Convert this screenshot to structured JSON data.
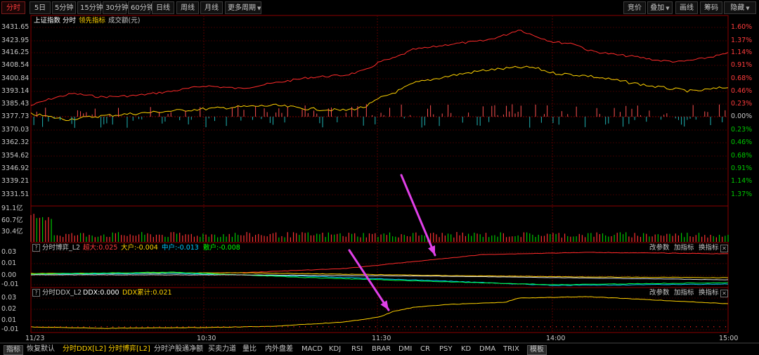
{
  "toolbar": {
    "left": [
      {
        "label": "分时",
        "active": true
      },
      {
        "label": "5日"
      },
      {
        "label": "5分钟"
      },
      {
        "label": "15分钟"
      },
      {
        "label": "30分钟"
      },
      {
        "label": "60分钟"
      },
      {
        "label": "日线"
      },
      {
        "label": "周线"
      },
      {
        "label": "月线"
      },
      {
        "label": "更多周期"
      }
    ],
    "right": [
      "竞价",
      "叠加",
      "画线",
      "筹码",
      "隐藏"
    ]
  },
  "main_chart": {
    "legend": [
      {
        "text": "上证指数",
        "color": "#ffffff"
      },
      {
        "text": "分时",
        "color": "#ffffff"
      },
      {
        "text": "领先指标",
        "color": "#ffd200"
      },
      {
        "text": "成交额(元)",
        "color": "#c8c8c8"
      }
    ],
    "left_axis": [
      "3431.65",
      "3423.95",
      "3416.25",
      "3408.54",
      "3400.84",
      "3393.14",
      "3385.43",
      "3377.73",
      "3370.03",
      "3362.32",
      "3354.62",
      "3346.92",
      "3339.21",
      "3331.51"
    ],
    "right_axis": [
      "1.60%",
      "1.37%",
      "1.14%",
      "0.91%",
      "0.68%",
      "0.46%",
      "0.23%",
      "0.00%",
      "0.23%",
      "0.46%",
      "0.68%",
      "0.91%",
      "1.14%",
      "1.37%"
    ],
    "right_axis_colors": {
      "up": "#ff3c3c",
      "zero": "#c8c8c8",
      "down": "#00c800"
    },
    "colors": {
      "price": "#ff2a2a",
      "lead": "#ffd200",
      "bar_up": "#ff5050",
      "bar_down": "#20b4b4"
    }
  },
  "volume_panel": {
    "axis": [
      "91.1亿",
      "60.7亿",
      "30.4亿"
    ],
    "bar_colors": {
      "up": "#ff3232",
      "down": "#00c800"
    }
  },
  "panel_boyi": {
    "title": "分时博弈_L2",
    "items": [
      {
        "text": "超大:0.025",
        "color": "#ff3c3c"
      },
      {
        "text": "大户:-0.004",
        "color": "#ffd200"
      },
      {
        "text": "中户:-0.013",
        "color": "#00c8ff"
      },
      {
        "text": "散户:-0.008",
        "color": "#00ff00"
      }
    ],
    "buttons": [
      "改参数",
      "加指标",
      "换指标"
    ],
    "axis": [
      "0.03",
      "0.01",
      "0.00",
      "-0.01"
    ],
    "colors": {
      "super": "#ff2a2a",
      "big": "#ffd200",
      "mid": "#00c8ff",
      "retail": "#00ff40",
      "white": "#dcdcdc"
    }
  },
  "panel_ddx": {
    "title": "分时DDX_L2",
    "items": [
      {
        "text": "DDX:0.000",
        "color": "#ffffff"
      },
      {
        "text": "DDX累计:0.021",
        "color": "#ffd200"
      }
    ],
    "buttons": [
      "改参数",
      "加指标",
      "换指标"
    ],
    "axis": [
      "0.03",
      "0.02",
      "0.01",
      "-0.01"
    ],
    "colors": {
      "cum": "#ffd200",
      "dots": "#ff2020"
    }
  },
  "time_axis": [
    "11/23",
    "10:30",
    "11:30",
    "14:00",
    "15:00"
  ],
  "bottom_tabs": [
    {
      "label": "指标",
      "style": "box"
    },
    {
      "label": "恢复默认"
    },
    {
      "label": "分时DDX[L2]",
      "style": "yel"
    },
    {
      "label": "分时博弈[L2]",
      "style": "yel"
    },
    {
      "label": "分时沪股通净额"
    },
    {
      "label": "买卖力道"
    },
    {
      "label": "量比"
    },
    {
      "label": "内外盘差"
    },
    {
      "label": "MACD"
    },
    {
      "label": "KDJ"
    },
    {
      "label": "RSI"
    },
    {
      "label": "BRAR"
    },
    {
      "label": "DMI"
    },
    {
      "label": "CR"
    },
    {
      "label": "PSY"
    },
    {
      "label": "KD"
    },
    {
      "label": "DMA"
    },
    {
      "label": "TRIX"
    },
    {
      "label": "模板",
      "style": "box"
    }
  ],
  "annotation_color": "#e040e8"
}
